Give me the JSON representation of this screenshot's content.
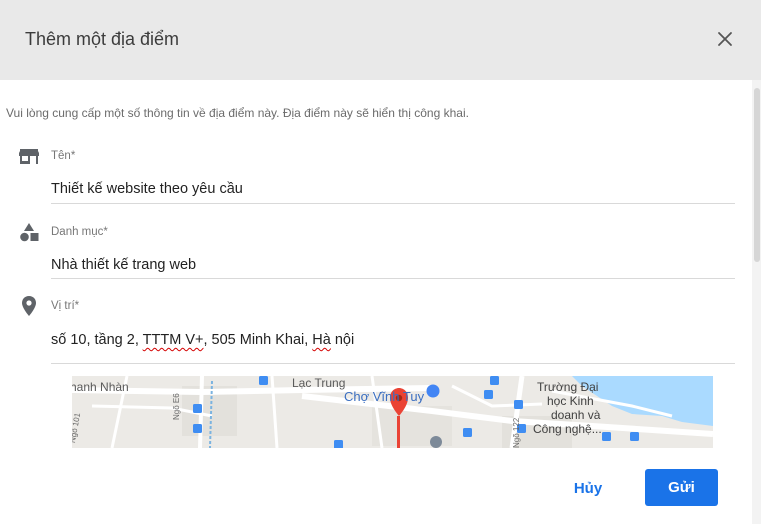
{
  "dialog": {
    "title": "Thêm một địa điểm",
    "close_icon": "close-icon"
  },
  "intro": "Vui lòng cung cấp một số thông tin về địa điểm này. Địa điểm này sẽ hiển thị công khai.",
  "fields": [
    {
      "label": "Tên*",
      "value": "Thiết kế website theo yêu cầu",
      "icon": "storefront-icon"
    },
    {
      "label": "Danh mục*",
      "value": "Nhà thiết kế trang web",
      "icon": "category-shapes-icon"
    },
    {
      "label": "Vị trí*",
      "value_parts": [
        "số 10, tầng 2, ",
        "TTTM V+",
        ", 505 Minh Khai, ",
        "Hà",
        " nội"
      ],
      "icon": "location-pin-icon"
    }
  ],
  "map": {
    "labels": {
      "thanh_nhan": "hanh Nhàn",
      "lac_trung": "Lạc Trung",
      "cho_vinh_tuy": "Chợ Vĩnh Tuy",
      "truong_1": "Trường Đại",
      "truong_2": "học Kinh",
      "truong_3": "doanh và",
      "truong_4": "Công nghệ...",
      "ngo_e6": "Ngõ E6",
      "ngo_101": "Ngõ 101",
      "ngo_122": "Ngõ 122"
    },
    "colors": {
      "road": "#ffffff",
      "block": "#e6e4df",
      "water": "#aadaff",
      "pin": "#ea4335",
      "transit": "#3f8df2"
    }
  },
  "buttons": {
    "cancel": "Hủy",
    "submit": "Gửi"
  },
  "colors": {
    "header_bg": "#e9e9e9",
    "accent": "#1a73e8"
  }
}
